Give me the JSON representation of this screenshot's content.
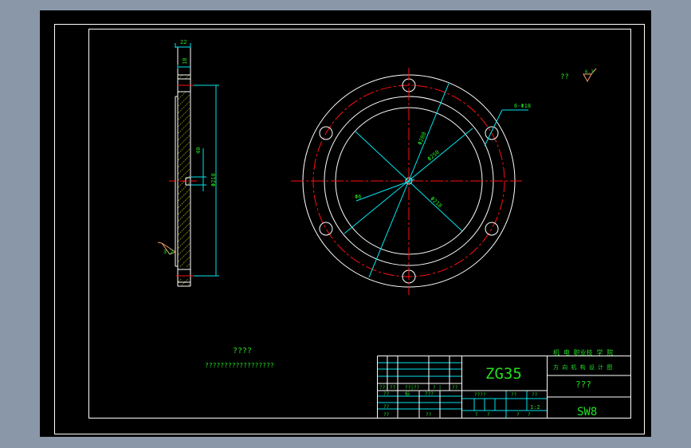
{
  "colors": {
    "background": "#8a97a9",
    "paper": "#000000",
    "line": "#ffffff",
    "dimension": "#00e5ee",
    "centerline": "#ff1010",
    "text": "#22e022",
    "hatch": "#e8e800",
    "roughness": "#f0a070"
  },
  "side_view": {
    "dims": [
      "22",
      "18",
      "40",
      "Φ218"
    ],
    "roughness": "3.2"
  },
  "front_view": {
    "dims": [
      "Φ280",
      "Φ250",
      "Φ6",
      "Φ218"
    ],
    "hole_callout": "6-Φ18"
  },
  "top_right": {
    "label": "??",
    "roughness": "6.3"
  },
  "notes": {
    "title": "????",
    "line1": "??????????????????"
  },
  "title_block": {
    "material": "ZG35",
    "school_line1": "机 电 职业技 学 院",
    "school_line2": "方 向 机 构 设 计 图",
    "part_name": "???",
    "drawing_no": "SW8",
    "scale": "1:2",
    "sub_labels": [
      "??",
      "??",
      "??|??",
      "? |",
      "??"
    ],
    "row_labels": [
      "??",
      "标",
      "???",
      "??",
      "??",
      "??",
      "????",
      "??",
      "??",
      "?",
      "?",
      "?",
      "?"
    ]
  }
}
